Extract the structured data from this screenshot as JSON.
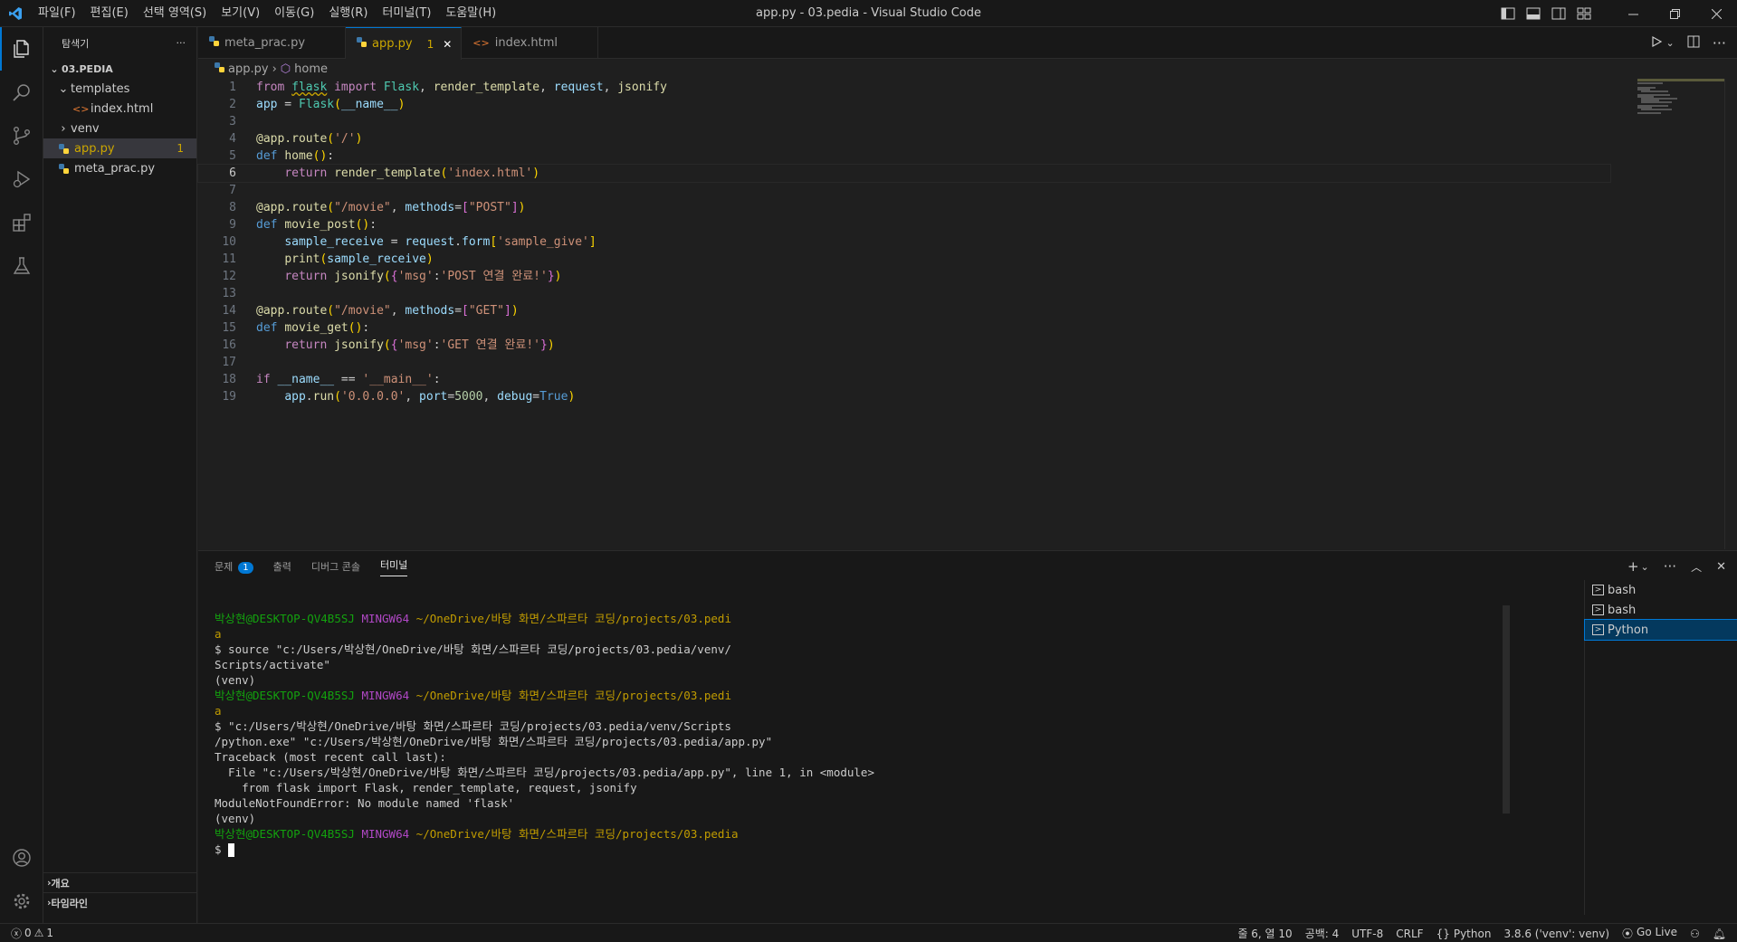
{
  "window": {
    "title": "app.py - 03.pedia - Visual Studio Code"
  },
  "menu": [
    "파일(F)",
    "편집(E)",
    "선택 영역(S)",
    "보기(V)",
    "이동(G)",
    "실행(R)",
    "터미널(T)",
    "도움말(H)"
  ],
  "sidebar": {
    "title": "탐색기",
    "more": "···",
    "root": "03.PEDIA",
    "items": [
      {
        "label": "templates",
        "type": "folder-open"
      },
      {
        "label": "index.html",
        "type": "html"
      },
      {
        "label": "venv",
        "type": "folder"
      },
      {
        "label": "app.py",
        "type": "python",
        "badge": "1"
      },
      {
        "label": "meta_prac.py",
        "type": "python"
      }
    ],
    "outline": "개요",
    "timeline": "타임라인"
  },
  "tabs": [
    {
      "label": "meta_prac.py",
      "type": "python"
    },
    {
      "label": "app.py",
      "type": "python",
      "modified": "1",
      "close": "✕"
    },
    {
      "label": "index.html",
      "type": "html"
    }
  ],
  "breadcrumb": {
    "file": "app.py",
    "symbol": "home"
  },
  "code_lines": [
    "from flask import Flask, render_template, request, jsonify",
    "app = Flask(__name__)",
    "",
    "@app.route('/')",
    "def home():",
    "    return render_template('index.html')",
    "",
    "@app.route(\"/movie\", methods=[\"POST\"])",
    "def movie_post():",
    "    sample_receive = request.form['sample_give']",
    "    print(sample_receive)",
    "    return jsonify({'msg':'POST 연결 완료!'})",
    "",
    "@app.route(\"/movie\", methods=[\"GET\"])",
    "def movie_get():",
    "    return jsonify({'msg':'GET 연결 완료!'})",
    "",
    "if __name__ == '__main__':",
    "    app.run('0.0.0.0', port=5000, debug=True)"
  ],
  "panel": {
    "tabs": [
      {
        "label": "문제",
        "badge": "1"
      },
      {
        "label": "출력"
      },
      {
        "label": "디버그 콘솔"
      },
      {
        "label": "터미널"
      }
    ],
    "terminals": [
      "bash",
      "bash",
      "Python"
    ]
  },
  "terminal": {
    "user": "박상현@DESKTOP-QV4B5SJ",
    "shell": "MINGW64",
    "path1": "~/OneDrive/바탕 화면/스파르타 코딩/projects/03.pedi",
    "path_wrap": "a",
    "cmd1a": "$ source \"c:/Users/박상현/OneDrive/바탕 화면/스파르타 코딩/projects/03.pedia/venv/",
    "cmd1b": "Scripts/activate\"",
    "venv": "(venv)",
    "cmd2a": "$ \"c:/Users/박상현/OneDrive/바탕 화면/스파르타 코딩/projects/03.pedia/venv/Scripts",
    "cmd2b": "/python.exe\" \"c:/Users/박상현/OneDrive/바탕 화면/스파르타 코딩/projects/03.pedia/app.py\"",
    "tb1": "Traceback (most recent call last):",
    "tb2": "  File \"c:/Users/박상현/OneDrive/바탕 화면/스파르타 코딩/projects/03.pedia/app.py\", line 1, in <module>",
    "tb3": "    from flask import Flask, render_template, request, jsonify",
    "tb4": "ModuleNotFoundError: No module named 'flask'",
    "path3": "~/OneDrive/바탕 화면/스파르타 코딩/projects/03.pedia",
    "prompt": "$ "
  },
  "status": {
    "errors": "0",
    "warnings": "1",
    "position": "줄 6, 열 10",
    "spaces": "공백: 4",
    "encoding": "UTF-8",
    "eol": "CRLF",
    "language": "Python",
    "interpreter": "3.8.6 ('venv': venv)",
    "golive": "Go Live"
  },
  "colors": {
    "accent": "#0078d4",
    "warning": "#cca700",
    "terminal_green": "#13a10e",
    "terminal_purple": "#b148c6",
    "terminal_yellow": "#c19c00"
  }
}
